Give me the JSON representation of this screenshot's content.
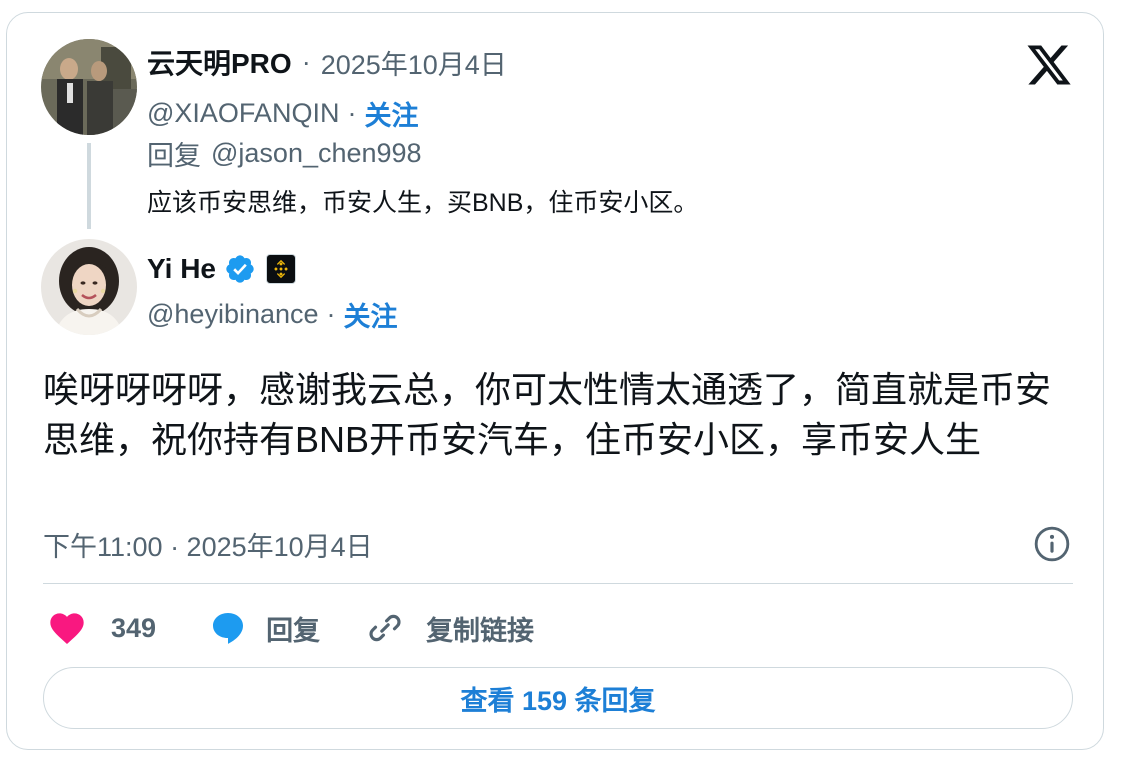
{
  "parent_tweet": {
    "name": "云天明PRO",
    "separator_dot": "·",
    "date": "2025年10月4日",
    "handle": "@XIAOFANQIN",
    "follow_label": "关注",
    "reply_prefix": "回复",
    "reply_to": "@jason_chen998",
    "text": "应该币安思维，币安人生，买BNB，住币安小区。"
  },
  "main_tweet": {
    "name": "Yi He",
    "handle": "@heyibinance",
    "follow_label": "关注",
    "text": "唉呀呀呀呀，感谢我云总，你可太性情太通透了，简直就是币安思维，祝你持有BNB开币安汽车，住币安小区，享币安人生",
    "timestamp": "下午11:00 · 2025年10月4日"
  },
  "actions": {
    "like_count": "349",
    "reply_label": "回复",
    "copy_link_label": "复制链接"
  },
  "view_replies_label": "查看 159 条回复",
  "icons": {
    "x_logo": "x-logo-icon",
    "verified": "verified-badge-icon",
    "affiliate": "binance-affiliate-icon",
    "info": "info-icon",
    "heart": "heart-icon",
    "reply": "reply-bubble-icon",
    "link": "link-icon"
  },
  "colors": {
    "accent_blue": "#1d7fd6",
    "verified_blue": "#1d9bf0",
    "heart_pink": "#f91880",
    "muted_text": "#536471",
    "border": "#cfd9de",
    "binance_yellow": "#f0b90b"
  }
}
